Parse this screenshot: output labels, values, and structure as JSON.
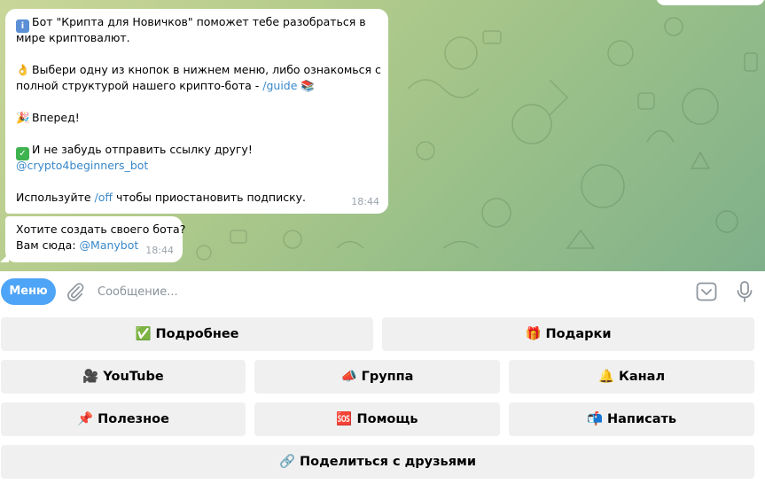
{
  "messages": [
    {
      "lines": {
        "l1": "Бот \"Крипта для Новичков\" поможет тебе разобраться в",
        "l2": "мире криптовалют.",
        "l3": "Выбери одну из кнопок в нижнем меню, либо ознакомься с",
        "l4_pre": "полной структурой нашего крипто-бота - ",
        "l4_link": "/guide",
        "l5": "Вперед!",
        "l6": "И не забудь отправить ссылку другу!",
        "l7_link": "@crypto4beginners_bot",
        "l8_pre": "Используйте ",
        "l8_link": "/off",
        "l8_post": " чтобы приостановить подписку."
      },
      "time": "18:44"
    },
    {
      "lines": {
        "l1": "Хотите создать своего бота?",
        "l2_pre": "Вам сюда: ",
        "l2_link": "@Manybot"
      },
      "time": "18:44"
    }
  ],
  "input": {
    "menu_label": "Меню",
    "placeholder": "Сообщение...",
    "value": ""
  },
  "keyboard": {
    "rows": [
      [
        {
          "emoji": "✅",
          "label": "Подробнее"
        },
        {
          "emoji": "🎁",
          "label": "Подарки"
        }
      ],
      [
        {
          "emoji": "🎥",
          "label": "YouTube"
        },
        {
          "emoji": "📣",
          "label": "Группа"
        },
        {
          "emoji": "🔔",
          "label": "Канал"
        }
      ],
      [
        {
          "emoji": "📌",
          "label": "Полезное"
        },
        {
          "emoji": "🆘",
          "label": "Помощь"
        },
        {
          "emoji": "📬",
          "label": "Написать"
        }
      ],
      [
        {
          "emoji": "🔗",
          "label": "Поделиться с друзьями"
        }
      ]
    ]
  },
  "colors": {
    "accent": "#4ea4f6",
    "link": "#3a89c9",
    "button_bg": "#f0f0f0"
  }
}
